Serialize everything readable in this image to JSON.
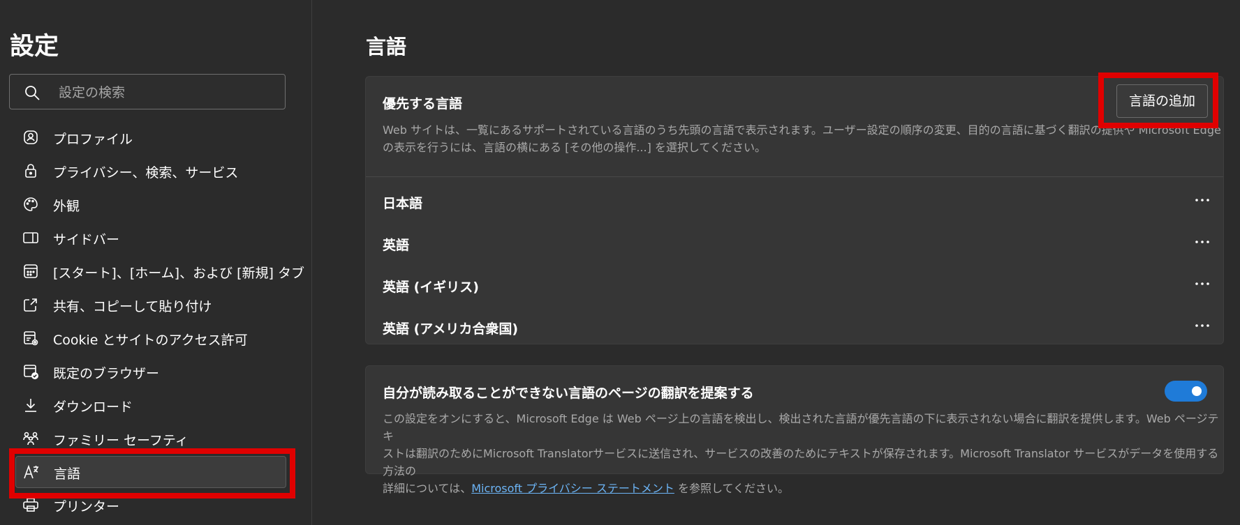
{
  "sidebar": {
    "title": "設定",
    "search_placeholder": "設定の検索",
    "items": [
      {
        "label": "プロファイル",
        "icon": "profile-icon"
      },
      {
        "label": "プライバシー、検索、サービス",
        "icon": "lock-icon"
      },
      {
        "label": "外観",
        "icon": "palette-icon"
      },
      {
        "label": "サイドバー",
        "icon": "sidebar-icon"
      },
      {
        "label": "[スタート]、[ホーム]、および [新規] タブ",
        "icon": "home-tab-icon"
      },
      {
        "label": "共有、コピーして貼り付け",
        "icon": "share-icon"
      },
      {
        "label": "Cookie とサイトのアクセス許可",
        "icon": "site-permissions-icon"
      },
      {
        "label": "既定のブラウザー",
        "icon": "default-browser-icon"
      },
      {
        "label": "ダウンロード",
        "icon": "download-icon"
      },
      {
        "label": "ファミリー セーフティ",
        "icon": "family-icon"
      },
      {
        "label": "言語",
        "icon": "language-icon",
        "active": true
      },
      {
        "label": "プリンター",
        "icon": "printer-icon"
      }
    ]
  },
  "main": {
    "title": "言語",
    "preferred": {
      "title": "優先する言語",
      "desc_line1": "Web サイトは、一覧にあるサポートされている言語のうち先頭の言語で表示されます。ユーザー設定の順序の変更、目的の言語に基づく翻訳の提供や Microsoft Edge",
      "desc_line2": "の表示を行うには、言語の横にある [その他の操作...] を選択してください。",
      "add_button": "言語の追加",
      "languages": [
        "日本語",
        "英語",
        "英語 (イギリス)",
        "英語 (アメリカ合衆国)"
      ]
    },
    "translate": {
      "title": "自分が読み取ることができない言語のページの翻訳を提案する",
      "desc_line1": "この設定をオンにすると、Microsoft Edge は Web ページ上の言語を検出し、検出された言語が優先言語の下に表示されない場合に翻訳を提供します。Web ページテキ",
      "desc_line2": "ストは翻訳のためにMicrosoft Translatorサービスに送信され、サービスの改善のためにテキストが保存されます。Microsoft Translator サービスがデータを使用する方法の",
      "desc_line3_prefix": "詳細については、",
      "desc_link": "Microsoft プライバシー ステートメント",
      "desc_line3_suffix": " を参照してください。",
      "toggle_on": true
    }
  },
  "colors": {
    "accent": "#1f7bd8",
    "highlight": "#e00000",
    "link": "#6cb4f5"
  }
}
